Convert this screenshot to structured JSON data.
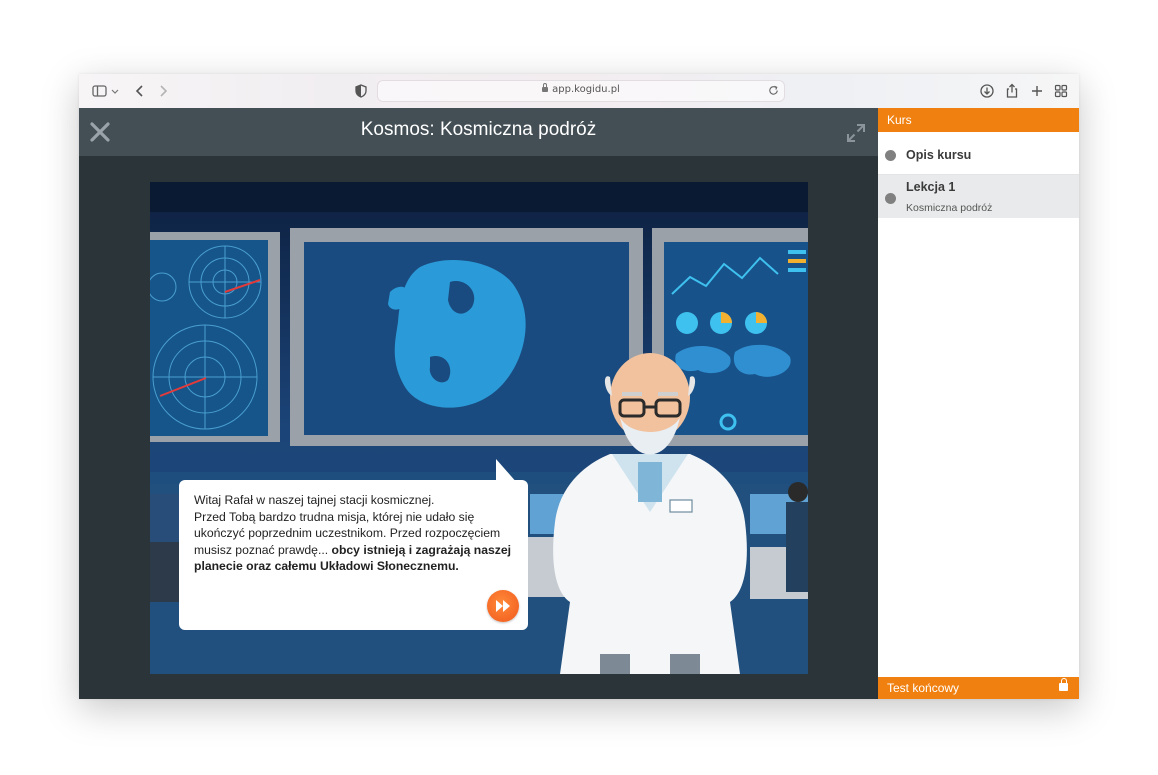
{
  "browser": {
    "url": "app.kogidu.pl",
    "icons": [
      "sidebar-toggle-icon",
      "chevron-down-icon",
      "back-icon",
      "forward-icon",
      "privacy-shield-icon",
      "lock-icon",
      "reload-icon",
      "download-icon",
      "share-icon",
      "new-tab-icon",
      "tab-overview-icon"
    ]
  },
  "player": {
    "title": "Kosmos: Kosmiczna podróż",
    "close_icon": "close-icon",
    "expand_icon": "fullscreen-icon",
    "dialog": {
      "text_line1": "Witaj Rafał w naszej tajnej stacji kosmicznej.",
      "text_line2": "Przed Tobą bardzo trudna misja, której nie udało się ukończyć poprzednim uczestnikom. Przed rozpoczęciem musisz poznać prawdę...",
      "text_bold": "obcy istnieją i zagrażają naszej planecie oraz całemu Układowi Słonecznemu.",
      "next_icon": "fast-forward-icon"
    }
  },
  "sidebar": {
    "header": "Kurs",
    "items": [
      {
        "label": "Opis kursu",
        "sub": ""
      },
      {
        "label": "Lekcja 1",
        "sub": "Kosmiczna podróż"
      }
    ],
    "footer": "Test końcowy",
    "footer_icon": "lock-icon"
  },
  "colors": {
    "accent": "#f08010",
    "player_bg": "#2b3439",
    "player_header": "#434e55",
    "next_button": "#f0581b"
  }
}
